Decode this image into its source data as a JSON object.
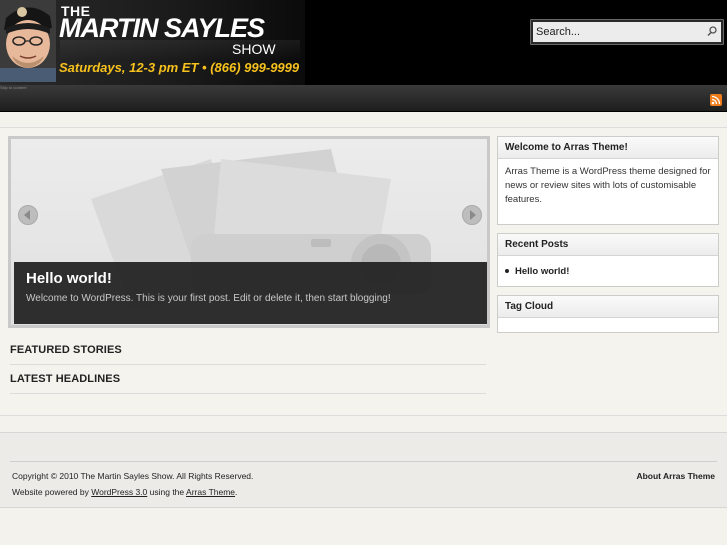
{
  "header": {
    "brand_the": "THE",
    "brand_name": "MARTIN SAYLES",
    "brand_show": "SHOW",
    "tagline": "Saturdays, 12-3 pm ET • (866) 999-9999",
    "search": {
      "placeholder": "Search...",
      "icon": "search-icon"
    }
  },
  "nav": {
    "tiny_text": "Skip to content",
    "rss_icon": "rss-icon"
  },
  "slider": {
    "title": "Hello world!",
    "excerpt": "Welcome to WordPress. This is your first post. Edit or delete it, then start blogging!",
    "prev_icon": "arrow-left-icon",
    "next_icon": "arrow-right-icon"
  },
  "sections": {
    "featured": "FEATURED STORIES",
    "latest": "LATEST HEADLINES"
  },
  "sidebar": {
    "welcome": {
      "title": "Welcome to Arras Theme!",
      "body": "Arras Theme is a WordPress theme designed for news or review sites with lots of customisable features."
    },
    "recent": {
      "title": "Recent Posts",
      "items": [
        "Hello world!"
      ]
    },
    "tagcloud": {
      "title": "Tag Cloud"
    }
  },
  "footer": {
    "copyright": "Copyright © 2010 The Martin Sayles Show. All Rights Reserved.",
    "powered_prefix": "Website powered by ",
    "wordpress_link": "WordPress 3.0",
    "powered_middle": " using the ",
    "arras_link": "Arras Theme",
    "powered_suffix": ".",
    "about_link": "About Arras Theme"
  },
  "colors": {
    "header_bg": "#000000",
    "tagline": "#f7c21d",
    "page_bg": "#f4f2ec",
    "rss": "#f07d1c"
  }
}
